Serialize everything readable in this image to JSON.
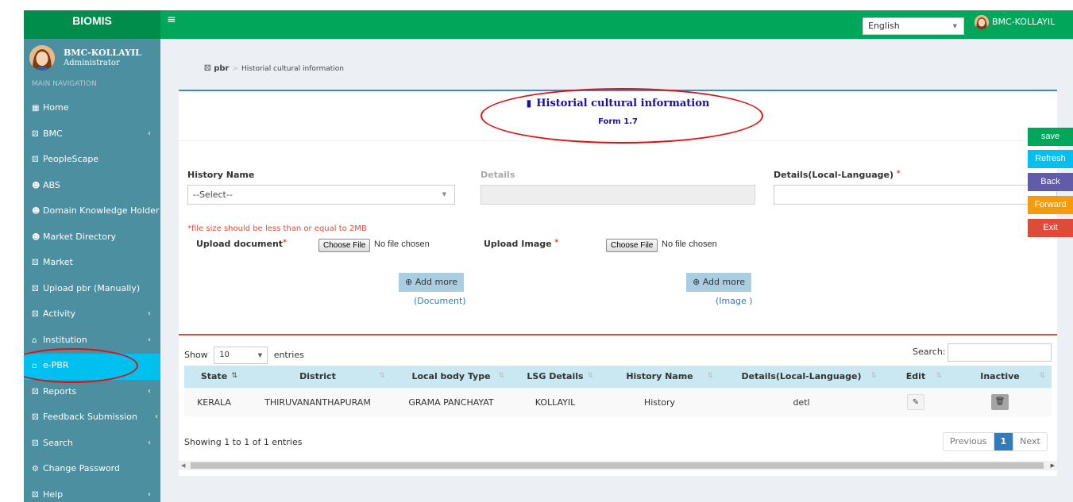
{
  "app": {
    "brand": "BIOMIS"
  },
  "user": {
    "name": "BMC-KOLLAYIL",
    "role": "Administrator"
  },
  "sidebar": {
    "header": "MAIN NAVIGATION",
    "items": [
      {
        "label": "Home",
        "icon": "grid-icon"
      },
      {
        "label": "BMC",
        "icon": "cubes-icon"
      },
      {
        "label": "PeopleScape",
        "icon": "cubes-icon"
      },
      {
        "label": "ABS",
        "icon": "users-icon"
      },
      {
        "label": "Domain Knowledge Holder",
        "icon": "users-icon"
      },
      {
        "label": "Market Directory",
        "icon": "users-icon"
      },
      {
        "label": "Market",
        "icon": "cubes-icon"
      },
      {
        "label": "Upload pbr (Manually)",
        "icon": "cubes-icon"
      },
      {
        "label": "Activity",
        "icon": "cubes-icon"
      },
      {
        "label": "Institution",
        "icon": "institution-icon"
      },
      {
        "label": "e-PBR",
        "icon": "square-icon"
      },
      {
        "label": "Reports",
        "icon": "cubes-icon"
      },
      {
        "label": "Feedback Submission",
        "icon": "cubes-icon"
      },
      {
        "label": "Search",
        "icon": "cubes-icon"
      },
      {
        "label": "Change Password",
        "icon": "cog-icon"
      },
      {
        "label": "Help",
        "icon": "cubes-icon"
      }
    ]
  },
  "topbar": {
    "menu_icon": "≡",
    "language": "English",
    "user": "BMC-KOLLAYIL"
  },
  "breadcrumb": {
    "root": "pbr",
    "separator": ">",
    "current": "Historial cultural information"
  },
  "form": {
    "title": "Historial cultural information",
    "subtitle": "Form 1.7",
    "history_name_label": "History Name",
    "history_name_value": "--Select--",
    "details_label": "Details",
    "local_label": "Details(Local-Language)",
    "required_mark": "*",
    "file_note": "*file size should be less than or equal to 2MB",
    "upload_doc_label": "Upload document",
    "upload_img_label": "Upload Image",
    "choose_file": "Choose File",
    "no_file": "No file chosen",
    "add_more": "Add more",
    "add_doc_link": "(Document)",
    "add_img_link": "(Image )"
  },
  "side_buttons": [
    {
      "label": "save",
      "color": "#00a65a"
    },
    {
      "label": "Refresh",
      "color": "#00c0ef"
    },
    {
      "label": "Back",
      "color": "#605ca8"
    },
    {
      "label": "Forward",
      "color": "#f39c12"
    },
    {
      "label": "Exit",
      "color": "#dd4b39"
    }
  ],
  "table": {
    "show": "Show",
    "length": "10",
    "entries": "entries",
    "search_label": "Search:",
    "columns": [
      "State",
      "District",
      "Local body Type",
      "LSG Details",
      "History Name",
      "Details(Local-Language)",
      "Edit",
      "Inactive"
    ],
    "rows": [
      [
        "KERALA",
        "THIRUVANANTHAPURAM",
        "GRAMA PANCHAYAT",
        "KOLLAYIL",
        "History",
        "detl"
      ]
    ],
    "info": "Showing 1 to 1 of 1 entries",
    "pager": {
      "previous": "Previous",
      "current": "1",
      "next": "Next"
    }
  }
}
